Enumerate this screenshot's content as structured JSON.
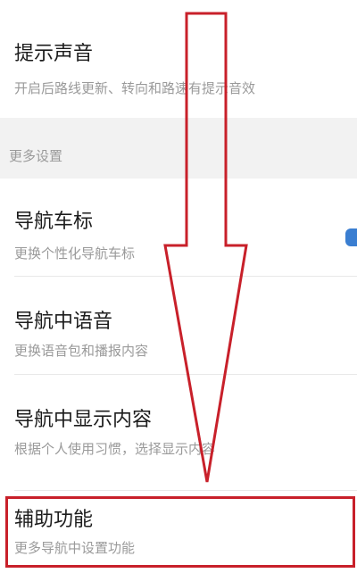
{
  "settings": {
    "prompt_sound": {
      "title": "提示声音",
      "subtitle": "开启后路线更新、转向和路速有提示音效"
    },
    "section_more": {
      "label": "更多设置"
    },
    "items": [
      {
        "title": "导航车标",
        "subtitle": "更换个性化导航车标"
      },
      {
        "title": "导航中语音",
        "subtitle": "更换语音包和播报内容"
      },
      {
        "title": "导航中显示内容",
        "subtitle": "根据个人使用习惯，选择显示内容"
      },
      {
        "title": "辅助功能",
        "subtitle": "更多导航中设置功能"
      }
    ]
  },
  "annotation": {
    "color": "#c8202a"
  }
}
